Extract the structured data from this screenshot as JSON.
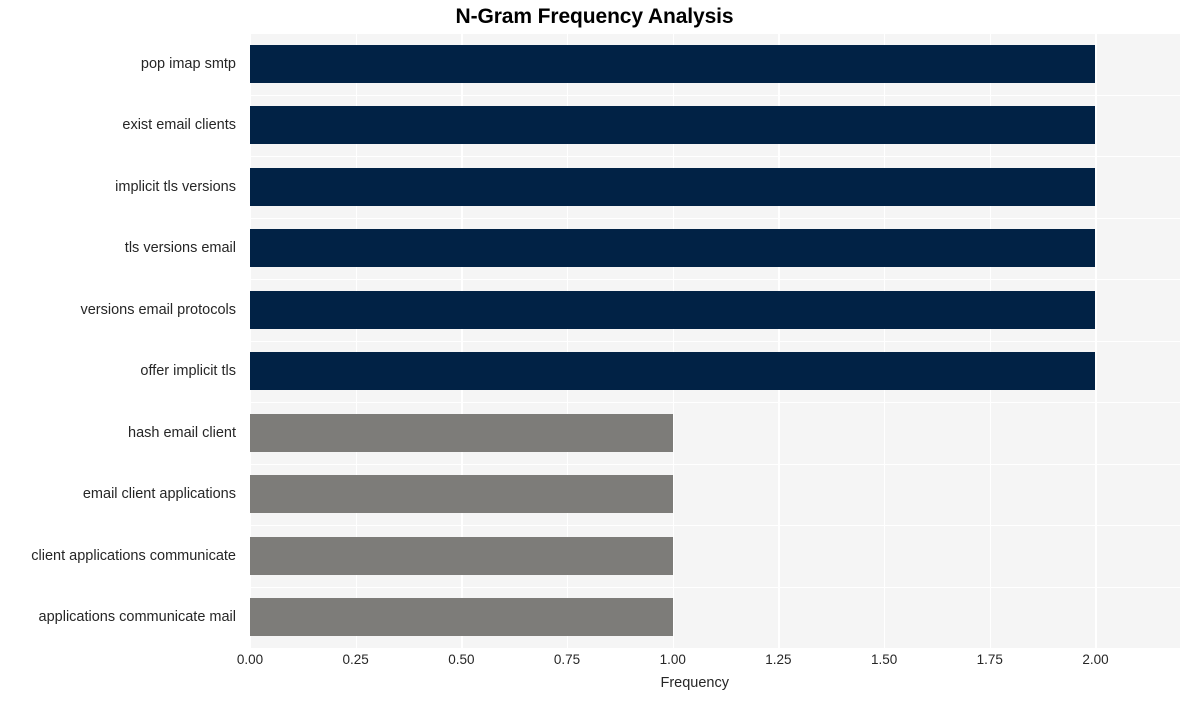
{
  "chart_data": {
    "type": "bar",
    "orientation": "horizontal",
    "title": "N-Gram Frequency Analysis",
    "xlabel": "Frequency",
    "ylabel": "",
    "categories": [
      "pop imap smtp",
      "exist email clients",
      "implicit tls versions",
      "tls versions email",
      "versions email protocols",
      "offer implicit tls",
      "hash email client",
      "email client applications",
      "client applications communicate",
      "applications communicate mail"
    ],
    "values": [
      2,
      2,
      2,
      2,
      2,
      2,
      1,
      1,
      1,
      1
    ],
    "bar_colors": [
      "#012245",
      "#012245",
      "#012245",
      "#012245",
      "#012245",
      "#012245",
      "#7d7c79",
      "#7d7c79",
      "#7d7c79",
      "#7d7c79"
    ],
    "xlim": [
      0,
      2.0
    ],
    "xticks": [
      0,
      0.25,
      0.5,
      0.75,
      1.0,
      1.25,
      1.5,
      1.75,
      2.0
    ],
    "xticklabels": [
      "0.00",
      "0.25",
      "0.50",
      "0.75",
      "1.00",
      "1.25",
      "1.50",
      "1.75",
      "2.00"
    ],
    "grid": true,
    "grid_color": "#ffffff",
    "plot_background": "#f5f5f5",
    "figure_background": "#ffffff",
    "legend": null,
    "axis_max_display": 2.2
  },
  "style": {
    "title_color": "#000000",
    "tick_label_color": "#262626",
    "axis_label_color": "#262626"
  }
}
